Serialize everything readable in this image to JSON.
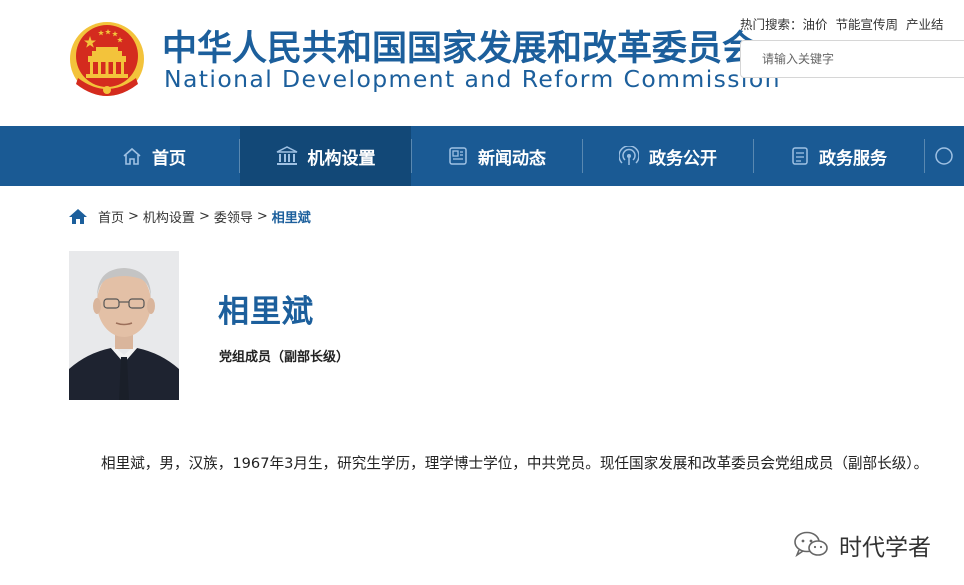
{
  "header": {
    "title_cn": "中华人民共和国国家发展和改革委员会",
    "title_en": "National Development and Reform Commission",
    "emblem_icon": "national-emblem-icon"
  },
  "hot_search": {
    "label": "热门搜索：",
    "items": [
      "油价",
      "节能宣传周",
      "产业结"
    ]
  },
  "search": {
    "placeholder": "请输入关键字"
  },
  "nav": {
    "items": [
      {
        "label": "首页",
        "icon": "home-icon"
      },
      {
        "label": "机构设置",
        "icon": "institution-icon",
        "active": true
      },
      {
        "label": "新闻动态",
        "icon": "news-icon"
      },
      {
        "label": "政务公开",
        "icon": "broadcast-icon"
      },
      {
        "label": "政务服务",
        "icon": "service-icon"
      }
    ]
  },
  "breadcrumb": {
    "items": [
      "首页",
      "机构设置",
      "委领导"
    ],
    "separator": ">",
    "current": "相里斌"
  },
  "profile": {
    "name": "相里斌",
    "title": "党组成员（副部长级）",
    "bio": "相里斌，男，汉族，1967年3月生，研究生学历，理学博士学位，中共党员。现任国家发展和改革委员会党组成员（副部长级）。"
  },
  "watermark": {
    "text": "时代学者",
    "icon": "wechat-icon"
  },
  "colors": {
    "brand_blue": "#1c5f9c",
    "nav_bg": "#1a5a94",
    "nav_active": "#124877",
    "emblem_red": "#d42b1e",
    "emblem_gold": "#f3c33b"
  }
}
